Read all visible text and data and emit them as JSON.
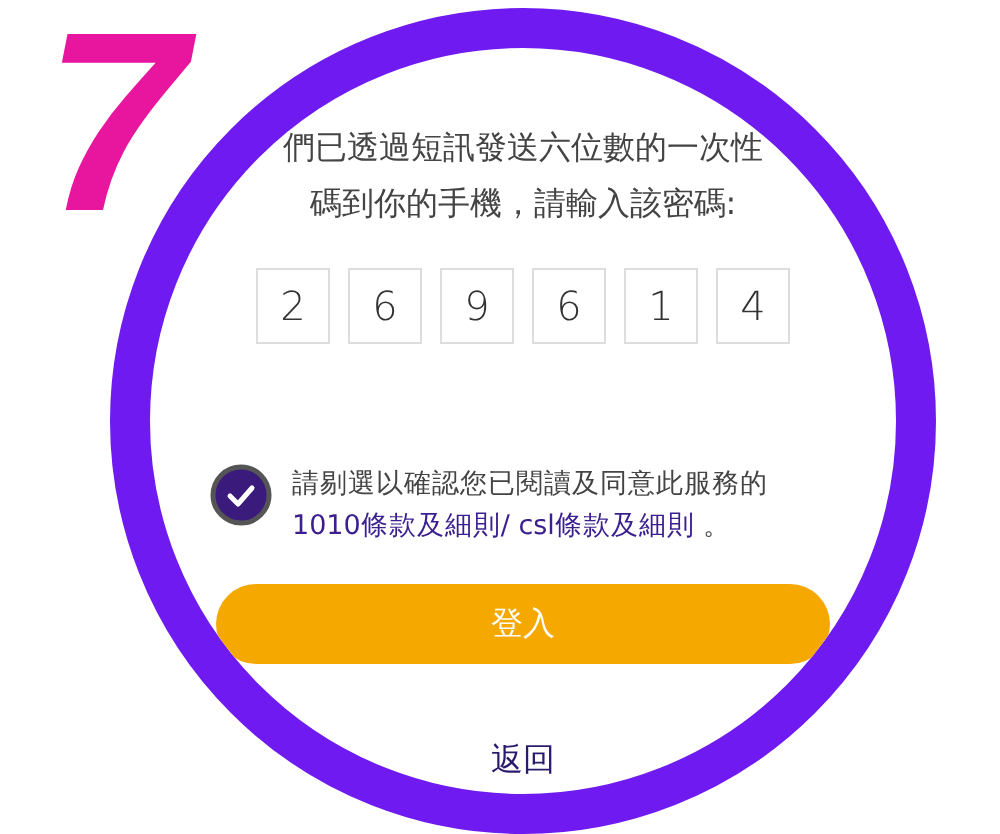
{
  "step_number": "7",
  "message": [
    "們已透過短訊發送六位數的一次性",
    "碼到你的手機，請輸入該密碼:"
  ],
  "otp_digits": [
    "2",
    "6",
    "9",
    "6",
    "1",
    "4"
  ],
  "consent": {
    "checked": true,
    "text": "請剔選以確認您已閱讀及同意此服務的",
    "links": [
      "1010條款及細則",
      "csl條款及細則"
    ],
    "separator": "/ ",
    "ending": " 。"
  },
  "login_button": "登入",
  "back_link": "返回"
}
